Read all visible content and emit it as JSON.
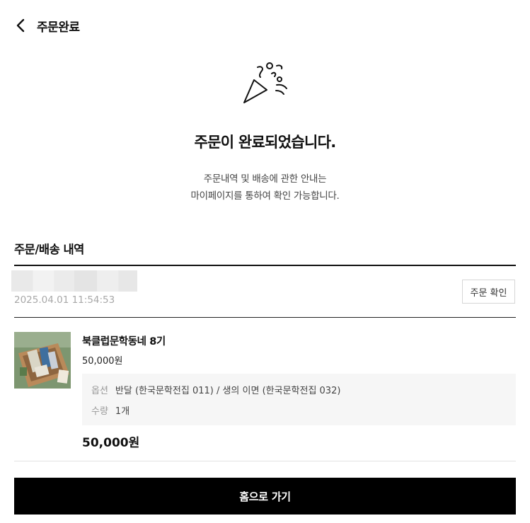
{
  "header": {
    "title": "주문완료",
    "back_icon": "chevron-left-icon"
  },
  "completion": {
    "icon": "party-popper-icon",
    "title": "주문이 완료되었습니다.",
    "guide_line1": "주문내역 및 배송에 관한 안내는",
    "guide_line2": "마이페이지를 통하여 확인 가능합니다."
  },
  "order_section": {
    "title": "주문/배송 내역",
    "order_date": "2025.04.01 11:54:53",
    "confirm_label": "주문 확인"
  },
  "product": {
    "name": "북클럽문학동네 8기",
    "price": "50,000원",
    "option_key": "옵션",
    "option_value": "반달 (한국문학전집 011) / 생의 이면 (한국문학전집 032)",
    "quantity_key": "수량",
    "quantity_value": "1개",
    "total": "50,000원"
  },
  "footer": {
    "home_label": "홈으로 가기"
  },
  "colors": {
    "primary_button": "#000000",
    "date_text": "#a8a8a8",
    "option_bg": "#f6f6f6"
  }
}
